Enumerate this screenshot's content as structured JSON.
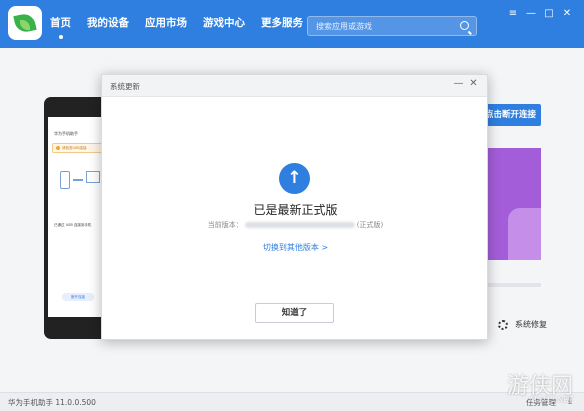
{
  "header": {
    "nav": [
      {
        "label": "首页",
        "active": true
      },
      {
        "label": "我的设备"
      },
      {
        "label": "应用市场"
      },
      {
        "label": "游戏中心"
      },
      {
        "label": "更多服务"
      }
    ],
    "search_placeholder": "搜索应用或游戏",
    "window_controls": [
      "≡",
      "—",
      "□",
      "✕"
    ]
  },
  "background": {
    "phone_title": "华为手机助手",
    "phone_warning": "请检查USB连接",
    "phone_caption": "已通过 USB 连接到手机",
    "phone_button": "断开连接",
    "connect_button": "点击断开连接",
    "system_repair": "系统修复"
  },
  "dialog": {
    "title": "系统更新",
    "controls": [
      "—",
      "✕"
    ],
    "icon": "↑",
    "heading": "已是最新正式版",
    "version_prefix": "当前版本：",
    "version_suffix": "(正式版)",
    "switch_link": "切换到其他版本 >",
    "ok_button": "知道了"
  },
  "statusbar": {
    "version": "华为手机助手 11.0.0.500",
    "task_manager": "任务管理",
    "download_icon": "⤓"
  },
  "watermark": {
    "main": "游侠网",
    "sub": "ALI213.NET"
  },
  "colors": {
    "brand_blue": "#2f7fe0",
    "banner_purple": "#a45dd9"
  }
}
